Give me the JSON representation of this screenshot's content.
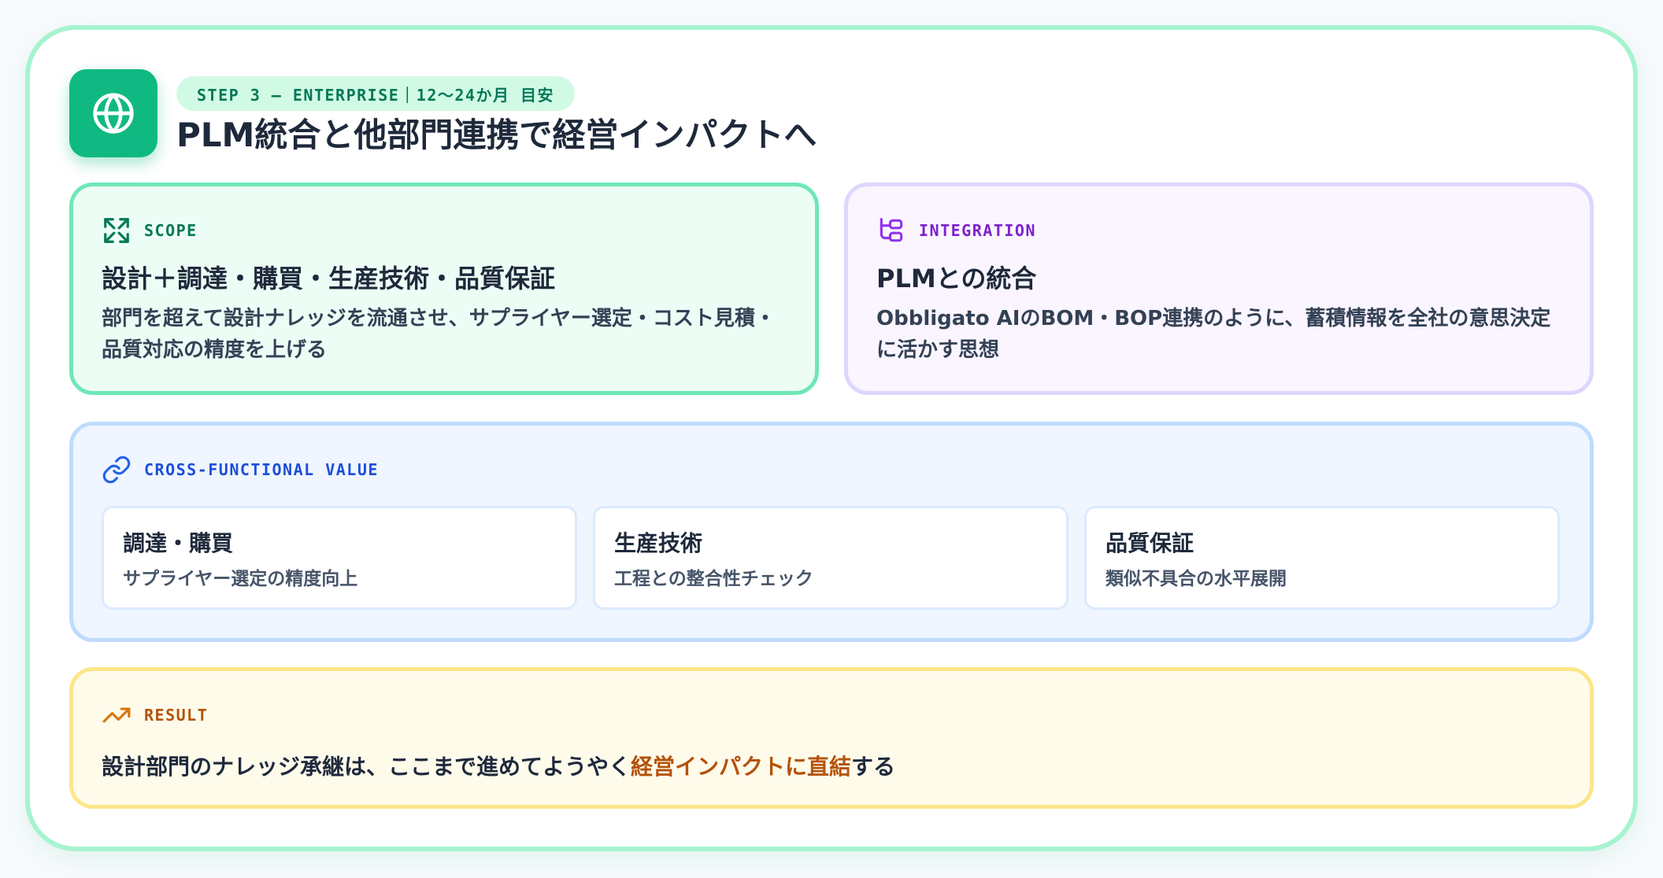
{
  "header": {
    "icon": "globe-icon",
    "step_label": "STEP 3 – ENTERPRISE｜12〜24か月 目安",
    "title": "PLM統合と他部門連携で経営インパクトへ",
    "accent_color": "#10b981"
  },
  "scope": {
    "icon": "expand-icon",
    "label": "SCOPE",
    "title": "設計＋調達・購買・生産技術・品質保証",
    "description": "部門を超えて設計ナレッジを流通させ、サプライヤー選定・コスト見積・品質対応の精度を上げる",
    "color": "#047857"
  },
  "integration": {
    "icon": "workflow-icon",
    "label": "INTEGRATION",
    "title": "PLMとの統合",
    "description": "Obbligato AIのBOM・BOP連携のように、蓄積情報を全社の意思決定に活かす思想",
    "color": "#7e22ce"
  },
  "cross_functional": {
    "icon": "link-icon",
    "label": "CROSS-FUNCTIONAL VALUE",
    "color": "#1d4ed8",
    "items": [
      {
        "title": "調達・購買",
        "description": "サプライヤー選定の精度向上"
      },
      {
        "title": "生産技術",
        "description": "工程との整合性チェック"
      },
      {
        "title": "品質保証",
        "description": "類似不具合の水平展開"
      }
    ]
  },
  "result": {
    "icon": "trending-up-icon",
    "label": "RESULT",
    "text_before": "設計部門のナレッジ承継は、ここまで進めてようやく",
    "highlight": "経営インパクトに直結",
    "text_after": "する",
    "color": "#b45309"
  }
}
